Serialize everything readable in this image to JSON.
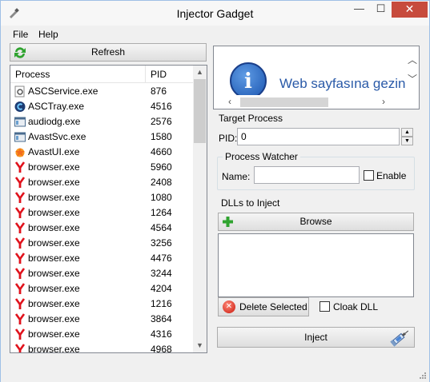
{
  "window": {
    "title": "Injector Gadget",
    "caption_min": "—",
    "caption_max": "☐",
    "caption_close": "✕"
  },
  "menu": {
    "file": "File",
    "help": "Help"
  },
  "refresh": {
    "label": "Refresh",
    "icon": "refresh-icon"
  },
  "process_list": {
    "headers": {
      "process": "Process",
      "pid": "PID"
    },
    "rows": [
      {
        "name": "ASCService.exe",
        "pid": "876",
        "icon": "service-icon"
      },
      {
        "name": "ASCTray.exe",
        "pid": "4516",
        "icon": "asc-tray-icon"
      },
      {
        "name": "audiodg.exe",
        "pid": "2576",
        "icon": "window-app-icon"
      },
      {
        "name": "AvastSvc.exe",
        "pid": "1580",
        "icon": "window-app-icon"
      },
      {
        "name": "AvastUI.exe",
        "pid": "4660",
        "icon": "avast-icon"
      },
      {
        "name": "browser.exe",
        "pid": "5960",
        "icon": "yandex-browser-icon"
      },
      {
        "name": "browser.exe",
        "pid": "2408",
        "icon": "yandex-browser-icon"
      },
      {
        "name": "browser.exe",
        "pid": "1080",
        "icon": "yandex-browser-icon"
      },
      {
        "name": "browser.exe",
        "pid": "1264",
        "icon": "yandex-browser-icon"
      },
      {
        "name": "browser.exe",
        "pid": "4564",
        "icon": "yandex-browser-icon"
      },
      {
        "name": "browser.exe",
        "pid": "3256",
        "icon": "yandex-browser-icon"
      },
      {
        "name": "browser.exe",
        "pid": "4476",
        "icon": "yandex-browser-icon"
      },
      {
        "name": "browser.exe",
        "pid": "3244",
        "icon": "yandex-browser-icon"
      },
      {
        "name": "browser.exe",
        "pid": "4204",
        "icon": "yandex-browser-icon"
      },
      {
        "name": "browser.exe",
        "pid": "1216",
        "icon": "yandex-browser-icon"
      },
      {
        "name": "browser.exe",
        "pid": "3864",
        "icon": "yandex-browser-icon"
      },
      {
        "name": "browser.exe",
        "pid": "4316",
        "icon": "yandex-browser-icon"
      },
      {
        "name": "browser.exe",
        "pid": "4968",
        "icon": "yandex-browser-icon"
      }
    ]
  },
  "browser_preview": {
    "text": "Web sayfasına gezin",
    "icon": "info-icon"
  },
  "target": {
    "group_label": "Target Process",
    "pid_label": "PID:",
    "pid_value": "0"
  },
  "watcher": {
    "group_label": "Process Watcher",
    "name_label": "Name:",
    "name_value": "",
    "enable_label": "Enable",
    "enable_checked": false
  },
  "dlls": {
    "group_label": "DLLs to Inject",
    "browse_label": "Browse",
    "items": [],
    "delete_label": "Delete Selected",
    "cloak_label": "Cloak DLL",
    "cloak_checked": false
  },
  "inject": {
    "label": "Inject",
    "icon": "syringe-icon"
  },
  "colors": {
    "accent_blue": "#2a5aa8",
    "close_red": "#c74b3d",
    "browser_red": "#e0121c",
    "green_plus": "#2fa32f"
  }
}
